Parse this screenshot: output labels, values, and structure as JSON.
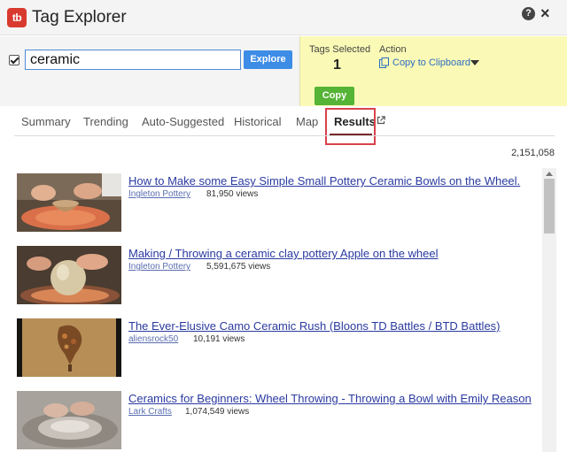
{
  "app": {
    "logo_text": "tb",
    "title": "Tag Explorer",
    "help_label": "?",
    "close_label": "×"
  },
  "search": {
    "checked": true,
    "query": "ceramic",
    "explore_label": "Explore"
  },
  "tags": {
    "selected_label": "Tags Selected",
    "selected_count": "1",
    "action_label": "Action",
    "action_value": "Copy to Clipboard",
    "copy_label": "Copy"
  },
  "tabs": [
    {
      "label": "Summary"
    },
    {
      "label": "Trending"
    },
    {
      "label": "Auto-Suggested"
    },
    {
      "label": "Historical"
    },
    {
      "label": "Map"
    },
    {
      "label": "Results",
      "active": true
    }
  ],
  "results": {
    "total": "2,151,058",
    "items": [
      {
        "title": "How to Make some Easy Simple Small Pottery Ceramic Bowls on the Wheel.",
        "channel": "Ingleton Pottery",
        "views": "81,950 views"
      },
      {
        "title": "Making / Throwing a ceramic clay pottery Apple on the wheel",
        "channel": "Ingleton Pottery",
        "views": "5,591,675 views"
      },
      {
        "title": "The Ever-Elusive Camo Ceramic Rush (Bloons TD Battles / BTD Battles)",
        "channel": "aliensrock50",
        "views": "10,191 views"
      },
      {
        "title": "Ceramics for Beginners: Wheel Throwing - Throwing a Bowl with Emily Reason",
        "channel": "Lark Crafts",
        "views": "1,074,549 views"
      }
    ]
  },
  "colors": {
    "accent_blue": "#3d8ce6",
    "copy_green": "#55b335",
    "tags_panel_bg": "#fafab6",
    "logo_red": "#d93a2f",
    "highlight_red": "#d9424a",
    "link_blue": "#2a3aa0"
  }
}
